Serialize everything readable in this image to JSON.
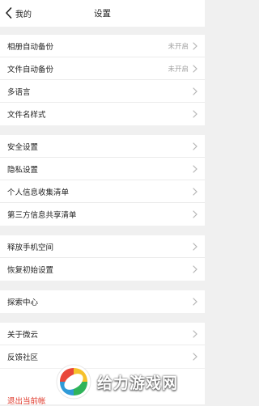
{
  "header": {
    "back_label": "我的",
    "title": "设置"
  },
  "sections": [
    {
      "items": [
        {
          "label": "相册自动备份",
          "value": "未开启"
        },
        {
          "label": "文件自动备份",
          "value": "未开启"
        },
        {
          "label": "多语言",
          "value": ""
        },
        {
          "label": "文件名样式",
          "value": ""
        }
      ]
    },
    {
      "items": [
        {
          "label": "安全设置"
        },
        {
          "label": "隐私设置"
        },
        {
          "label": "个人信息收集清单"
        },
        {
          "label": "第三方信息共享清单"
        }
      ]
    },
    {
      "items": [
        {
          "label": "释放手机空间"
        },
        {
          "label": "恢复初始设置"
        }
      ]
    },
    {
      "items": [
        {
          "label": "探索中心"
        }
      ]
    },
    {
      "items": [
        {
          "label": "关于微云"
        },
        {
          "label": "反馈社区"
        }
      ]
    }
  ],
  "logout": {
    "label": "退出当前帐"
  },
  "watermark": {
    "text": "给力游戏网"
  },
  "colors": {
    "background": "#f0f0f0",
    "danger": "#e0392b",
    "secondary_text": "#a0a0a0"
  },
  "icons": {
    "back": "chevron-left-icon",
    "row": "chevron-right-icon"
  }
}
